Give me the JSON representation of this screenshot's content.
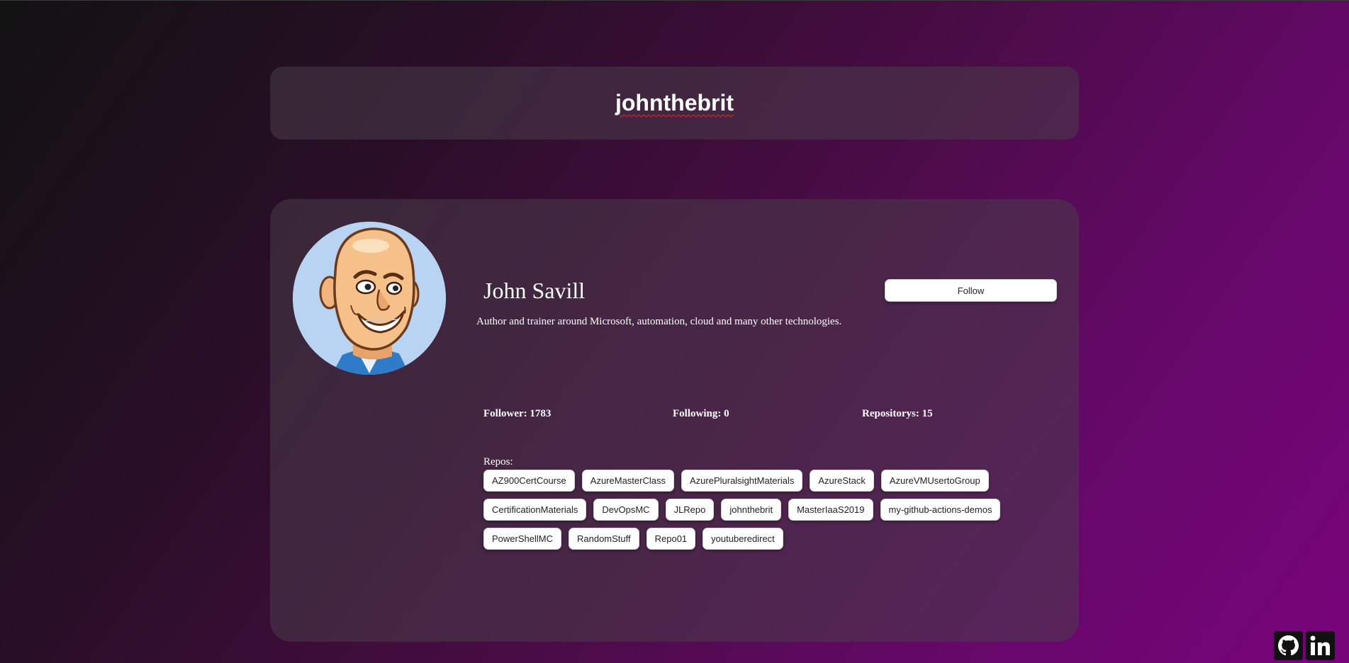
{
  "header": {
    "title": "johnthebrit"
  },
  "profile": {
    "name": "John Savill",
    "bio": "Author and trainer around Microsoft, automation, cloud and many other technologies.",
    "follow_label": "Follow",
    "avatar_icon": "cartoon-avatar-icon",
    "stats": {
      "followers": "Follower: 1783",
      "following": "Following: 0",
      "repositories": "Repositorys: 15"
    },
    "repos_label": "Repos:",
    "repos": [
      "AZ900CertCourse",
      "AzureMasterClass",
      "AzurePluralsightMaterials",
      "AzureStack",
      "AzureVMUsertoGroup",
      "CertificationMaterials",
      "DevOpsMC",
      "JLRepo",
      "johnthebrit",
      "MasterIaaS2019",
      "my-github-actions-demos",
      "PowerShellMC",
      "RandomStuff",
      "Repo01",
      "youtuberedirect"
    ]
  },
  "social": {
    "github_icon": "github-icon",
    "linkedin_icon": "linkedin-icon"
  },
  "colors": {
    "background_start": "#121212",
    "background_end": "#78047a",
    "card": "#483c48",
    "chip": "#ffffff"
  }
}
